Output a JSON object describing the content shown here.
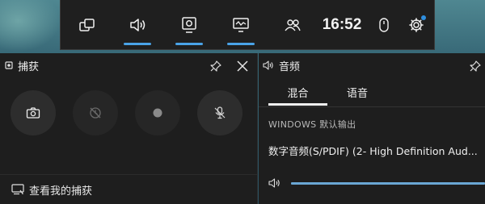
{
  "topbar": {
    "clock": "16:52",
    "buttons": [
      {
        "icon": "widget-menu-icon",
        "active": false
      },
      {
        "icon": "audio-icon",
        "active": true
      },
      {
        "icon": "capture-icon",
        "active": true
      },
      {
        "icon": "performance-icon",
        "active": true
      },
      {
        "icon": "social-icon",
        "active": false
      }
    ],
    "mouse_icon": "mouse-icon",
    "settings_icon": "gear-icon",
    "accent": "#4aa3e8"
  },
  "capture": {
    "title": "捕获",
    "buttons": [
      "camera-icon",
      "record-last-icon",
      "record-dot-icon",
      "mic-off-icon"
    ],
    "footer_label": "查看我的捕获"
  },
  "audio": {
    "title": "音频",
    "tabs": [
      {
        "label": "混合",
        "selected": true
      },
      {
        "label": "语音",
        "selected": false
      }
    ],
    "section_label": "WINDOWS 默认输出",
    "device": "数字音频(S/PDIF) (2- High Definition Aud...",
    "volume": 1.0
  }
}
